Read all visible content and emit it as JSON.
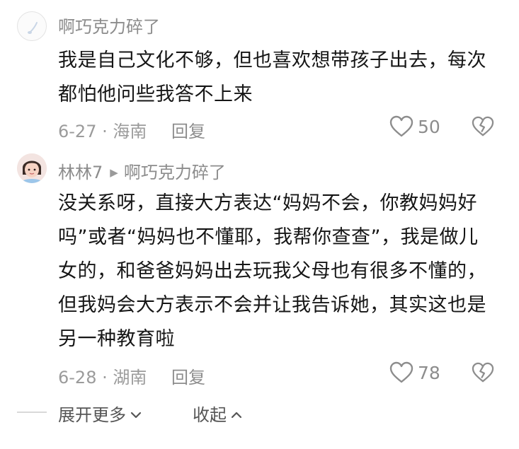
{
  "comments": [
    {
      "username": "啊巧克力碎了",
      "text": "我是自己文化不够，但也喜欢想带孩子出去，每次都怕他问些我答不上来",
      "date_location": "6-27 · 海南",
      "reply_label": "回复",
      "like_count": "50"
    },
    {
      "username": "林林7",
      "reply_to": "啊巧克力碎了",
      "text": "没关系呀，直接大方表达“妈妈不会，你教妈妈好吗”或者“妈妈也不懂耶，我帮你查查”，我是做儿女的，和爸爸妈妈出去玩我父母也有很多不懂的，但我妈会大方表示不会并让我告诉她，其实这也是另一种教育啦",
      "date_location": "6-28 · 湖南",
      "reply_label": "回复",
      "like_count": "78"
    }
  ],
  "footer": {
    "expand_label": "展开更多",
    "collapse_label": "收起"
  },
  "icons": {
    "like": "heart-outline-icon",
    "dislike": "broken-heart-icon",
    "expand": "chevron-down-icon",
    "collapse": "chevron-up-icon"
  },
  "colors": {
    "text": "#161616",
    "secondary": "#8c8c8c"
  }
}
